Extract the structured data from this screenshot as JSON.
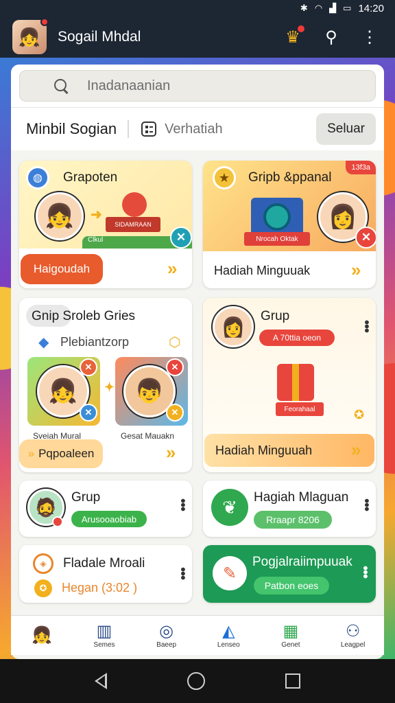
{
  "status_bar": {
    "time": "14:20",
    "icons": [
      "bluetooth-icon",
      "wifi-icon",
      "signal-icon",
      "battery-icon"
    ]
  },
  "app_bar": {
    "title": "Sogail Mhdal"
  },
  "search": {
    "placeholder": "Inadanaanian"
  },
  "tabs": {
    "title": "Minbil Sogian",
    "secondary": "Verhatiah",
    "button": "Seluar"
  },
  "cards": {
    "c1": {
      "title": "Grapoten",
      "banner": "SIDAMRAAN",
      "small": "Clkul",
      "button": "Haigoudah"
    },
    "c2": {
      "title": "Gripb &ppanal",
      "corner": "13f3a",
      "banner": "Nrocah Oktak",
      "button": "Hadiah Minguuak"
    },
    "c3": {
      "title": "Gnip Sroleb Gries",
      "sub": "Plebiantzorp",
      "left_name": "Sveiah Mural",
      "right_name": "Gesat Mauakn",
      "button": "Pqpoaleen"
    },
    "c4": {
      "title": "Grup",
      "tag": "A 70ttia oeon",
      "gift_label": "Feorahaal",
      "button": "Hadiah Minguuah"
    },
    "c5": {
      "title": "Grup",
      "pill": "Arusooaobiab"
    },
    "c6": {
      "title": "Hagiah Mlaguan",
      "pill": "Rraapr 8206"
    },
    "c7": {
      "title": "Fladale Mroali",
      "sub": "Hegan (3:02 )"
    },
    "c8": {
      "title": "Pogjalraiimpuuak",
      "pill": "Patbon eoes"
    }
  },
  "bottom_nav": [
    {
      "label": "",
      "icon": "avatar-icon"
    },
    {
      "label": "Semes",
      "icon": "book-icon"
    },
    {
      "label": "Baeep",
      "icon": "chat-icon"
    },
    {
      "label": "Lenseo",
      "icon": "megaphone-icon"
    },
    {
      "label": "Genet",
      "icon": "calendar-icon"
    },
    {
      "label": "Leagpel",
      "icon": "person-icon"
    }
  ],
  "colors": {
    "accent_orange": "#e85b2c",
    "accent_green": "#2fa84f",
    "accent_yellow": "#f2b01e",
    "dark_bar": "#1d2633"
  }
}
